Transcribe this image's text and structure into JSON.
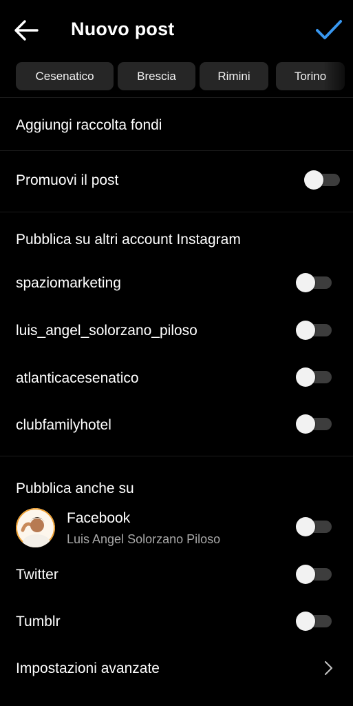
{
  "header": {
    "title": "Nuovo post",
    "back_icon": "arrow-left-icon",
    "confirm_icon": "checkmark-icon",
    "accent_color": "#3897f0"
  },
  "locations": [
    "Cesenatico",
    "Brescia",
    "Rimini",
    "Torino"
  ],
  "options": {
    "fundraiser": "Aggiungi raccolta fondi",
    "promote": {
      "label": "Promuovi il post",
      "enabled": false
    }
  },
  "instagram_accounts": {
    "heading": "Pubblica su altri account Instagram",
    "accounts": [
      {
        "name": "spaziomarketing",
        "enabled": false
      },
      {
        "name": "luis_angel_solorzano_piloso",
        "enabled": false
      },
      {
        "name": "atlanticacesenatico",
        "enabled": false
      },
      {
        "name": "clubfamilyhotel",
        "enabled": false
      }
    ]
  },
  "share_also": {
    "heading": "Pubblica anche su",
    "facebook": {
      "name": "Facebook",
      "account": "Luis Angel Solorzano Piloso",
      "enabled": false
    },
    "twitter": {
      "name": "Twitter",
      "enabled": false
    },
    "tumblr": {
      "name": "Tumblr",
      "enabled": false
    }
  },
  "advanced": {
    "label": "Impostazioni avanzate",
    "icon": "chevron-right-icon"
  }
}
